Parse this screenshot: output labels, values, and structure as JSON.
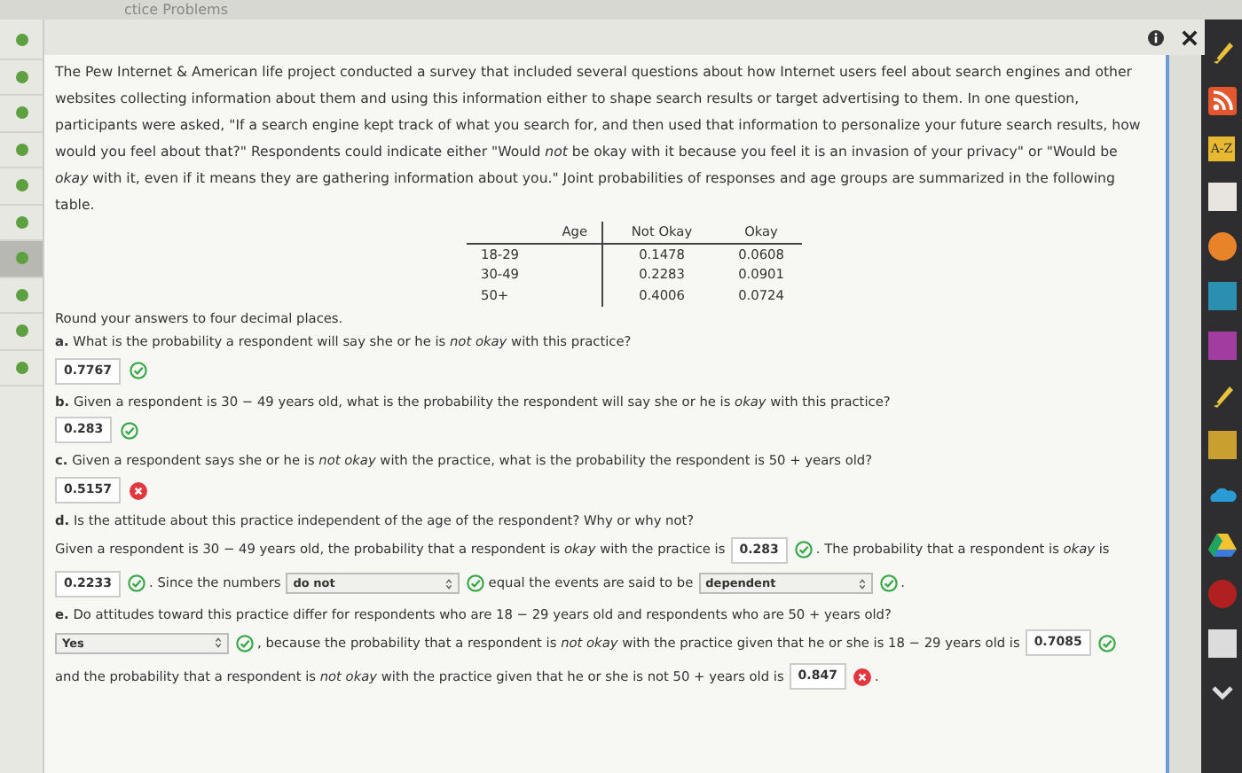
{
  "page_title": "ctice Problems",
  "sidebar": {
    "items": [
      {
        "selected": false
      },
      {
        "selected": false
      },
      {
        "selected": false
      },
      {
        "selected": false
      },
      {
        "selected": false
      },
      {
        "selected": false
      },
      {
        "selected": true
      },
      {
        "selected": false
      },
      {
        "selected": false
      },
      {
        "selected": false
      }
    ]
  },
  "problem": {
    "intro": "The Pew Internet & American life project conducted a survey that included several questions about how Internet users feel about search engines and other websites collecting information about them and using this information either to shape search results or target advertising to them. In one question, participants were asked, \"If a search engine kept track of what you search for, and then used that information to personalize your future search results, how would you feel about that?\" Respondents could indicate either \"Would *not* be okay with it because you feel it is an invasion of your privacy\" or \"Would be *okay* with it, even if it means they are gathering information about you.\" Joint probabilities of responses and age groups are summarized in the following table.",
    "table": {
      "columns": [
        "Age",
        "Not Okay",
        "Okay"
      ],
      "rows": [
        [
          "18-29",
          "0.1478",
          "0.0608"
        ],
        [
          "30-49",
          "0.2283",
          "0.0901"
        ],
        [
          "50+",
          "0.4006",
          "0.0724"
        ]
      ]
    },
    "instruction": "Round your answers to four decimal places.",
    "parts": [
      {
        "letter": "a.",
        "question": "What is the probability a respondent will say she or he is *not okay* with this practice?",
        "answer": "0.7767",
        "correct": true
      },
      {
        "letter": "b.",
        "question": "Given a respondent is 30 − 49 years old, what is the probability the respondent will say she or he is *okay* with this practice?",
        "answer": "0.283",
        "correct": true
      },
      {
        "letter": "c.",
        "question": "Given a respondent says she or he is *not okay* with the practice, what is the probability the respondent is 50 + years old?",
        "answer": "0.5157",
        "correct": false
      }
    ],
    "part_d": {
      "letter": "d.",
      "question": "Is the attitude about this practice independent of the age of the respondent? Why or why not?",
      "segments": [
        {
          "kind": "text",
          "text": "Given a respondent is 30 − 49 years old, the probability that a respondent is *okay* with the practice is"
        },
        {
          "kind": "input",
          "value": "0.283",
          "correct": true
        },
        {
          "kind": "text",
          "text": ". The probability that a respondent is *okay* is"
        },
        {
          "kind": "input",
          "value": "0.2233",
          "correct": true
        },
        {
          "kind": "text",
          "text": ". Since the numbers"
        },
        {
          "kind": "select",
          "value": "do not",
          "correct": true
        },
        {
          "kind": "text",
          "text": "equal the events are said to be"
        },
        {
          "kind": "select",
          "value": "dependent",
          "correct": true
        },
        {
          "kind": "text",
          "text": "."
        }
      ]
    },
    "part_e": {
      "letter": "e.",
      "question": "Do attitudes toward this practice differ for respondents who are 18 − 29 years old and respondents who are 50 + years old?",
      "segments": [
        {
          "kind": "select",
          "value": "Yes",
          "correct": true
        },
        {
          "kind": "text",
          "text": ", because the probability that a respondent is *not okay* with the practice given that he or she is 18 − 29 years old is"
        },
        {
          "kind": "input",
          "value": "0.7085",
          "correct": true
        },
        {
          "kind": "text",
          "text": "and the probability that a respondent is *not okay* with the practice given that he or she is not 50 + years old is"
        },
        {
          "kind": "input",
          "value": "0.847",
          "correct": false
        },
        {
          "kind": "text",
          "text": "."
        }
      ]
    }
  },
  "dock": {
    "items": [
      {
        "kind": "pen"
      },
      {
        "kind": "rss"
      },
      {
        "kind": "label",
        "text": "A-Z"
      },
      {
        "kind": "tile",
        "color": "#e8e4e0"
      },
      {
        "kind": "circle",
        "color": "#e8832a"
      },
      {
        "kind": "tile",
        "color": "#2a8fb0"
      },
      {
        "kind": "tile",
        "color": "#a33ca0"
      },
      {
        "kind": "pen"
      },
      {
        "kind": "tile",
        "color": "#c9a030"
      },
      {
        "kind": "cloud"
      },
      {
        "kind": "triangle"
      },
      {
        "kind": "circle",
        "color": "#b02020"
      },
      {
        "kind": "tile",
        "color": "#dcdcdc"
      },
      {
        "kind": "chevron"
      }
    ]
  }
}
